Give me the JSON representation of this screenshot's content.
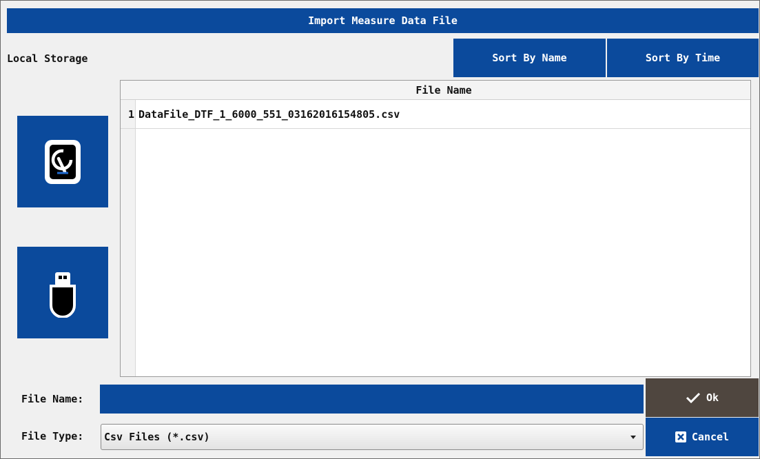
{
  "window": {
    "title": "Import Measure Data File"
  },
  "storage": {
    "label": "Local Storage"
  },
  "sort": {
    "by_name": "Sort By Name",
    "by_time": "Sort By Time"
  },
  "devices": [
    {
      "icon": "hard-disk-icon"
    },
    {
      "icon": "usb-drive-icon"
    }
  ],
  "table": {
    "header": "File Name",
    "rows": [
      {
        "num": "1",
        "name": "DataFile_DTF_1_6000_551_03162016154805.csv"
      }
    ]
  },
  "file_name": {
    "label": "File Name:",
    "value": ""
  },
  "file_type": {
    "label": "File Type:",
    "selected": "Csv Files (*.csv)"
  },
  "buttons": {
    "ok": "Ok",
    "cancel": "Cancel"
  },
  "colors": {
    "accent": "#0b4a9c",
    "ok_bg": "#4f463f",
    "background": "#f0f0f0"
  }
}
